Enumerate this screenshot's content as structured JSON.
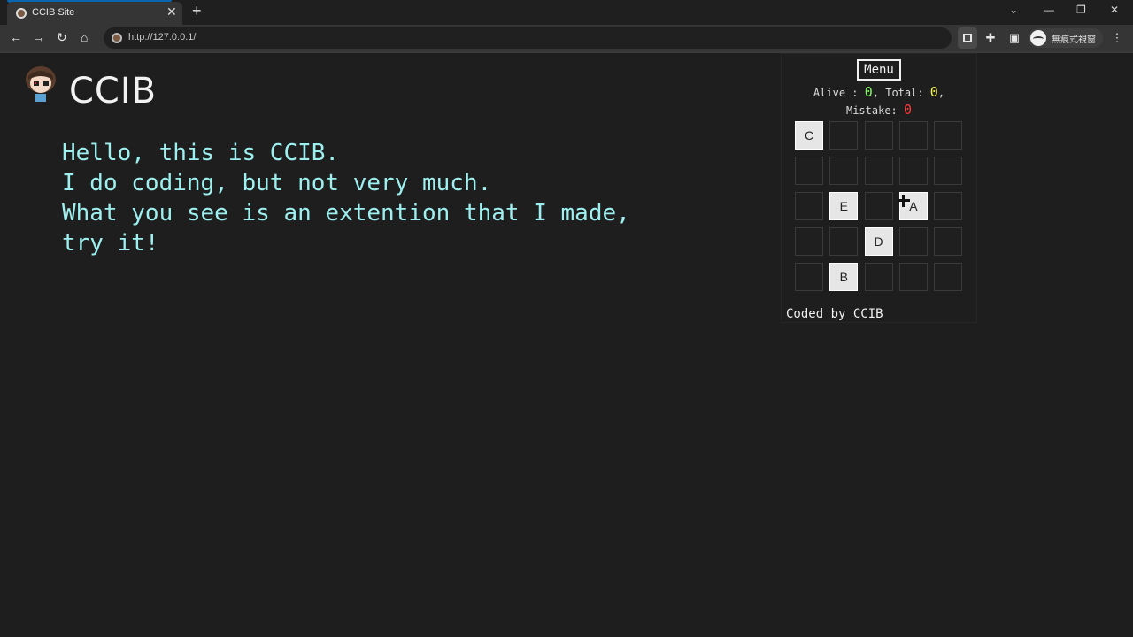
{
  "browser": {
    "tab_title": "CCIB Site",
    "url": "http://127.0.0.1/",
    "profile_label": "無痕式視窗"
  },
  "page": {
    "title": "CCIB",
    "intro_lines": [
      "Hello, this is CCIB.",
      "I do coding, but not very much.",
      "What you see is an extention that I made,",
      "try it!"
    ]
  },
  "popup": {
    "menu_label": "Menu",
    "alive_label": "Alive",
    "alive_value": "0",
    "total_label": "Total",
    "total_value": "0",
    "mistake_label": "Mistake",
    "mistake_value": "0",
    "grid": [
      [
        "C",
        "",
        "",
        "",
        ""
      ],
      [
        "",
        "",
        "",
        "",
        ""
      ],
      [
        "",
        "E",
        "",
        "A",
        ""
      ],
      [
        "",
        "",
        "D",
        "",
        ""
      ],
      [
        "",
        "B",
        "",
        "",
        ""
      ]
    ],
    "credit": "Coded by CCIB"
  },
  "colors": {
    "intro_text": "#9ef0f0",
    "alive": "#7fff5f",
    "total": "#f5f55a",
    "mistake": "#ff3b3b"
  }
}
